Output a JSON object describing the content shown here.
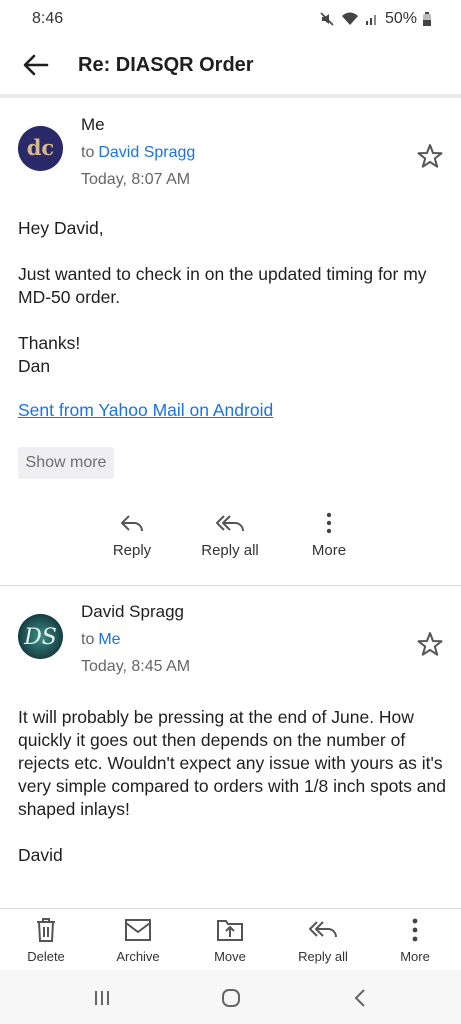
{
  "status_bar": {
    "time": "8:46",
    "battery": "50%"
  },
  "header": {
    "subject": "Re: DIASQR Order"
  },
  "messages": [
    {
      "avatar_initials": "dc",
      "sender": "Me",
      "to_prefix": "to",
      "recipient": "David Spragg",
      "time": "Today, 8:07 AM",
      "body": "Hey David,\n\nJust wanted to check in on the updated timing for my MD-50 order.\n\nThanks!\nDan",
      "signature_link": "Sent from Yahoo Mail on Android",
      "show_more": "Show more",
      "actions": {
        "reply": "Reply",
        "reply_all": "Reply all",
        "more": "More"
      }
    },
    {
      "avatar_initials": "DS",
      "sender": "David Spragg",
      "to_prefix": "to",
      "recipient": "Me",
      "time": "Today, 8:45 AM",
      "body": "It will probably be pressing at the end of June. How quickly it goes out then depends on the number of rejects etc.  Wouldn't expect any issue with yours as it's very simple compared to orders with 1/8 inch spots and shaped inlays!\n\nDavid"
    }
  ],
  "toolbar": {
    "delete": "Delete",
    "archive": "Archive",
    "move": "Move",
    "reply_all": "Reply all",
    "more": "More"
  },
  "colors": {
    "link": "#1a73e8",
    "avatar_dc": "#2a2a6a",
    "avatar_ds": "#1d4a4e"
  }
}
